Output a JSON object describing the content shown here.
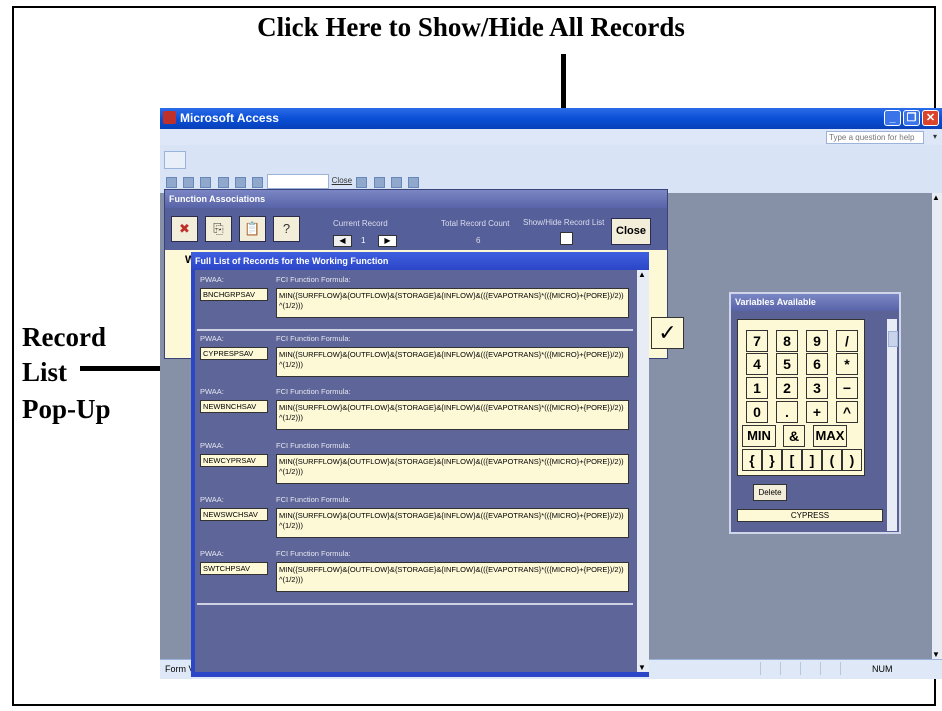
{
  "annotations": {
    "top": "Click Here to Show/Hide All Records",
    "left_lines": [
      "Record",
      "List",
      "Pop-Up"
    ]
  },
  "window": {
    "title": "Microsoft Access",
    "help_placeholder": "Type a question for help",
    "toolbar_close": "Close",
    "status_left": "Form View",
    "status_right": "NUM"
  },
  "function_assoc": {
    "title": "Function Associations",
    "current_record_label": "Current Record",
    "current_record_value": "1",
    "total_label": "Total Record Count",
    "total_value": "6",
    "showhide_label": "Show/Hide Record List",
    "close_label": "Close",
    "partial_letter": "W",
    "check_glyph": "✓"
  },
  "popup": {
    "title": "Full List of Records for the Working Function",
    "pwaa_label": "PWAA:",
    "formula_label": "FCI Function Formula:",
    "records": [
      {
        "pwaa": "BNCHGRPSAV",
        "formula": "MIN({SURFFLOW}&{OUTFLOW}&{STORAGE}&{INFLOW}&(({EVAPOTRANS}*(({MICRO}+{PORE})/2))^(1/2)))"
      },
      {
        "pwaa": "CYPRESPSAV",
        "formula": "MIN({SURFFLOW}&{OUTFLOW}&{STORAGE}&{INFLOW}&(({EVAPOTRANS}*(({MICRO}+{PORE})/2))^(1/2)))"
      },
      {
        "pwaa": "NEWBNCHSAV",
        "formula": "MIN({SURFFLOW}&{OUTFLOW}&{STORAGE}&{INFLOW}&(({EVAPOTRANS}*(({MICRO}+{PORE})/2))^(1/2)))"
      },
      {
        "pwaa": "NEWCYPRSAV",
        "formula": "MIN({SURFFLOW}&{OUTFLOW}&{STORAGE}&{INFLOW}&(({EVAPOTRANS}*(({MICRO}+{PORE})/2))^(1/2)))"
      },
      {
        "pwaa": "NEWSWCHSAV",
        "formula": "MIN({SURFFLOW}&{OUTFLOW}&{STORAGE}&{INFLOW}&(({EVAPOTRANS}*(({MICRO}+{PORE})/2))^(1/2)))"
      },
      {
        "pwaa": "SWTCHPSAV",
        "formula": "MIN({SURFFLOW}&{OUTFLOW}&{STORAGE}&{INFLOW}&(({EVAPOTRANS}*(({MICRO}+{PORE})/2))^(1/2)))"
      }
    ]
  },
  "variables": {
    "title": "Variables Available",
    "keys": [
      [
        "7",
        "8",
        "9",
        "/"
      ],
      [
        "4",
        "5",
        "6",
        "*"
      ],
      [
        "1",
        "2",
        "3",
        "−"
      ],
      [
        "0",
        ".",
        "+",
        "^"
      ],
      [
        "MIN",
        "&",
        "MAX"
      ],
      [
        "{",
        "}",
        "[",
        "]",
        "(",
        ")"
      ]
    ],
    "delete_label": "Delete",
    "selected_var": "CYPRESS"
  }
}
